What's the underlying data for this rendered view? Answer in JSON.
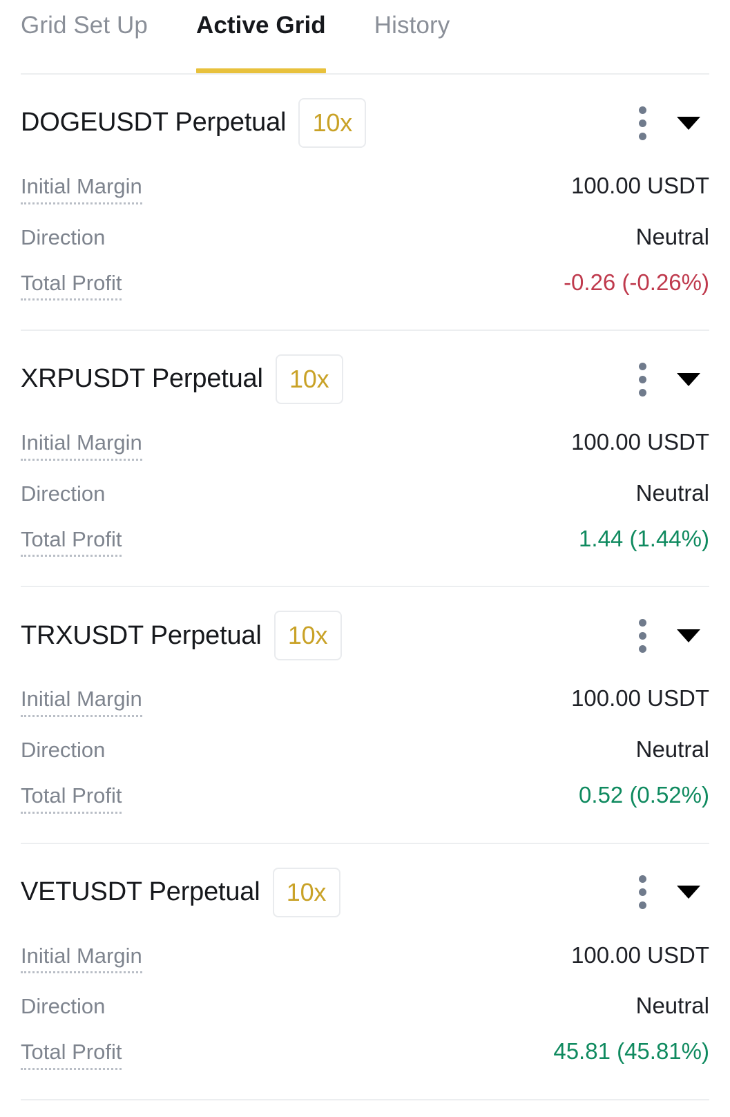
{
  "tabs": [
    {
      "label": "Grid Set Up",
      "active": false
    },
    {
      "label": "Active Grid",
      "active": true
    },
    {
      "label": "History",
      "active": false
    }
  ],
  "colors": {
    "accent_yellow": "#e8c13c",
    "badge_gold": "#c9a227",
    "profit_green": "#0f8a5f",
    "loss_red": "#bf3a4d",
    "label_gray": "#7e848e",
    "value_dark": "#1e2026",
    "divider": "#eceef0"
  },
  "labels": {
    "initial_margin": "Initial Margin",
    "direction": "Direction",
    "total_profit": "Total Profit"
  },
  "icons": {
    "more_menu": "three-dots-vertical-icon",
    "collapse": "caret-down-icon"
  },
  "cards": [
    {
      "symbol": "DOGEUSDT Perpetual",
      "leverage": "10x",
      "initial_margin": "100.00 USDT",
      "direction": "Neutral",
      "total_profit": "-0.26 (-0.26%)",
      "profit_sign": "neg"
    },
    {
      "symbol": "XRPUSDT Perpetual",
      "leverage": "10x",
      "initial_margin": "100.00 USDT",
      "direction": "Neutral",
      "total_profit": "1.44 (1.44%)",
      "profit_sign": "pos"
    },
    {
      "symbol": "TRXUSDT Perpetual",
      "leverage": "10x",
      "initial_margin": "100.00 USDT",
      "direction": "Neutral",
      "total_profit": "0.52 (0.52%)",
      "profit_sign": "pos"
    },
    {
      "symbol": "VETUSDT Perpetual",
      "leverage": "10x",
      "initial_margin": "100.00 USDT",
      "direction": "Neutral",
      "total_profit": "45.81 (45.81%)",
      "profit_sign": "pos"
    }
  ]
}
